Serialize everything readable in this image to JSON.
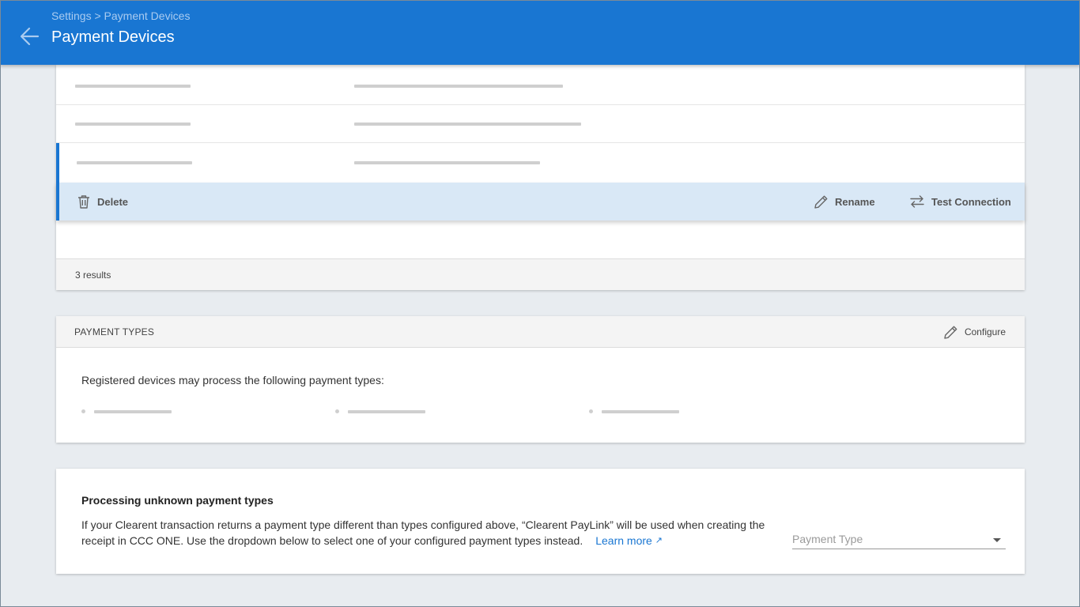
{
  "header": {
    "breadcrumb": "Settings > Payment Devices",
    "title": "Payment Devices",
    "back_icon": "arrow-left-icon",
    "color": "#1976d2"
  },
  "devices": {
    "actions": {
      "delete_label": "Delete",
      "rename_label": "Rename",
      "test_connection_label": "Test Connection"
    },
    "results_text": "3 results",
    "selected_row_color": "#d9e8f6"
  },
  "payment_types": {
    "title": "PAYMENT TYPES",
    "configure_label": "Configure",
    "description": "Registered devices may process the following payment types:"
  },
  "unknown_types": {
    "title": "Processing unknown payment types",
    "description": "If your Clearent transaction returns a payment type different than types configured above, “Clearent PayLink” will be used when creating the receipt in CCC ONE. Use the dropdown below to select one of your configured payment types instead.",
    "learn_more": "Learn more",
    "learn_more_icon": "↗",
    "select_placeholder": "Payment Type"
  }
}
